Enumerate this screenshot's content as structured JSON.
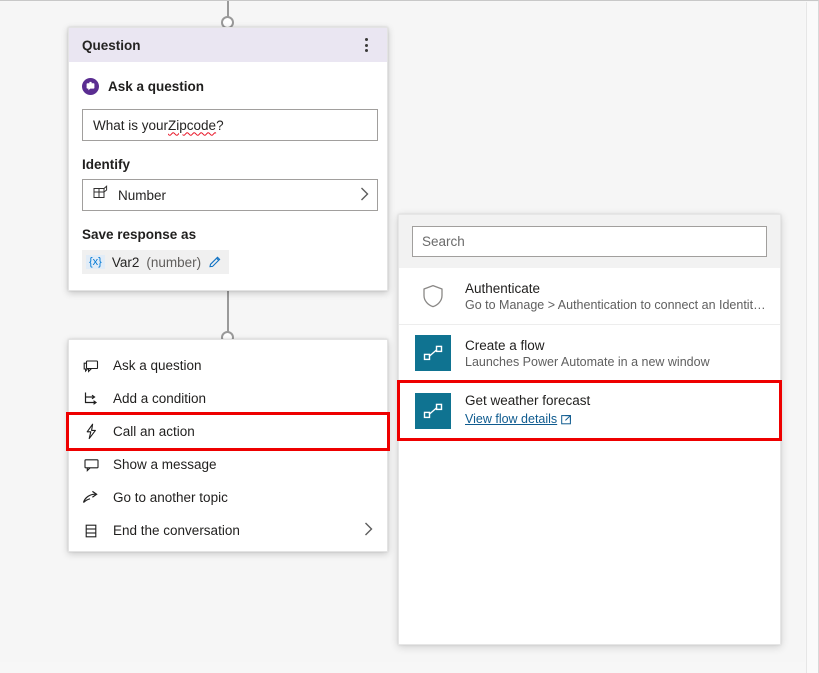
{
  "canvas": {
    "connector_top_name": "top-connector",
    "connector_bottom_name": "bottom-connector"
  },
  "question_card": {
    "title": "Question",
    "menu_icon": "more-options-icon",
    "ask": {
      "icon": "ask-question-icon",
      "label": "Ask a question"
    },
    "question_input": {
      "value_prefix": "What is your ",
      "value_misspelled": "Zipcode",
      "value_suffix": "?",
      "full_value": "What is your Zipcode?"
    },
    "identify": {
      "label": "Identify",
      "icon": "entity-grid-icon",
      "value": "Number",
      "chevron": "chevron-right-icon"
    },
    "save_response": {
      "label": "Save response as",
      "brace": "{x}",
      "variable_name": "Var2",
      "variable_type": "(number)",
      "edit_icon": "pencil-icon"
    }
  },
  "node_menu": {
    "items": [
      {
        "label": "Ask a question",
        "icon": "ask-question-node-icon",
        "chevron": false,
        "highlighted": false
      },
      {
        "label": "Add a condition",
        "icon": "condition-branch-icon",
        "chevron": false,
        "highlighted": false
      },
      {
        "label": "Call an action",
        "icon": "lightning-bolt-icon",
        "chevron": false,
        "highlighted": true
      },
      {
        "label": "Show a message",
        "icon": "message-bubble-icon",
        "chevron": false,
        "highlighted": false
      },
      {
        "label": "Go to another topic",
        "icon": "redirect-arrow-icon",
        "chevron": false,
        "highlighted": false
      },
      {
        "label": "End the conversation",
        "icon": "end-conversation-icon",
        "chevron": true,
        "highlighted": false
      }
    ]
  },
  "action_panel": {
    "search": {
      "placeholder": "Search",
      "value": "",
      "icon": "search-input"
    },
    "rows": [
      {
        "title": "Authenticate",
        "subtitle": "Go to Manage > Authentication to connect an Identity...",
        "icon": "shield-icon",
        "icon_kind": "shield",
        "link": null,
        "selected": false
      },
      {
        "title": "Create a flow",
        "subtitle": "Launches Power Automate in a new window",
        "icon": "power-automate-flow-icon",
        "icon_kind": "flow",
        "link": null,
        "selected": false
      },
      {
        "title": "Get weather forecast",
        "subtitle": null,
        "icon": "power-automate-flow-icon",
        "icon_kind": "flow",
        "link": {
          "label": "View flow details",
          "external_icon": "open-in-new-icon"
        },
        "selected": true
      }
    ]
  },
  "colors": {
    "header_lavender": "#EAE6F2",
    "purple_accent": "#5A2D91",
    "teal_flow": "#0F7391",
    "highlight_red": "#EE0000",
    "link_blue": "#0F5B8F",
    "canvas_gray": "#F6F6F6"
  }
}
